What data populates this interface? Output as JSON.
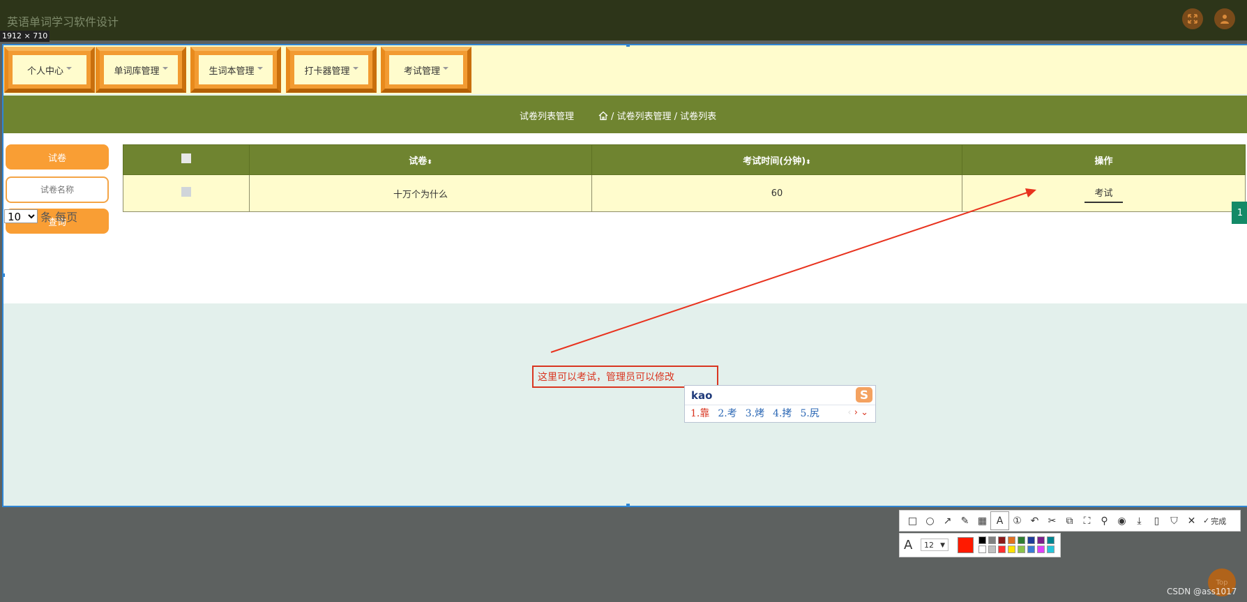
{
  "app": {
    "title": "英语单词学习软件设计"
  },
  "capture": {
    "dimensions": "1912 × 710"
  },
  "nav": {
    "items": [
      "个人中心",
      "单词库管理",
      "生词本管理",
      "打卡器管理",
      "考试管理"
    ]
  },
  "breadcrumb": {
    "title": "试卷列表管理",
    "path": "/ 试卷列表管理 / 试卷列表"
  },
  "sidebar": {
    "tab": "试卷",
    "search_placeholder": "试卷名称",
    "query": "查询"
  },
  "pager": {
    "page_size": "10",
    "per_page_label": "条 每页",
    "current_page": "1"
  },
  "table": {
    "headers": [
      "试卷",
      "考试时间(分钟)",
      "操作"
    ],
    "rows": [
      {
        "name": "十万个为什么",
        "duration": "60",
        "action": "考试"
      }
    ]
  },
  "annotation": {
    "text": "这里可以考试，管理员可以修改",
    "color": "#d93520"
  },
  "ime": {
    "input": "kao",
    "candidates": [
      "1.靠",
      "2.考",
      "3.烤",
      "4.拷",
      "5.尻"
    ]
  },
  "screenshot_toolbar": {
    "done_label": "完成",
    "font_size": "12",
    "current_color": "#ff1a00",
    "palette": [
      "#000000",
      "#808080",
      "#8b1a1a",
      "#e07020",
      "#2e7d32",
      "#1e3c9a",
      "#7b1f8c",
      "#00838f",
      "#ffffff",
      "#c0c0c0",
      "#ff3030",
      "#ffe000",
      "#8bc34a",
      "#3a7bd5",
      "#e040fb",
      "#26c6da"
    ]
  },
  "scroll_top": {
    "label": "Top"
  },
  "watermark": "CSDN @ass1017"
}
